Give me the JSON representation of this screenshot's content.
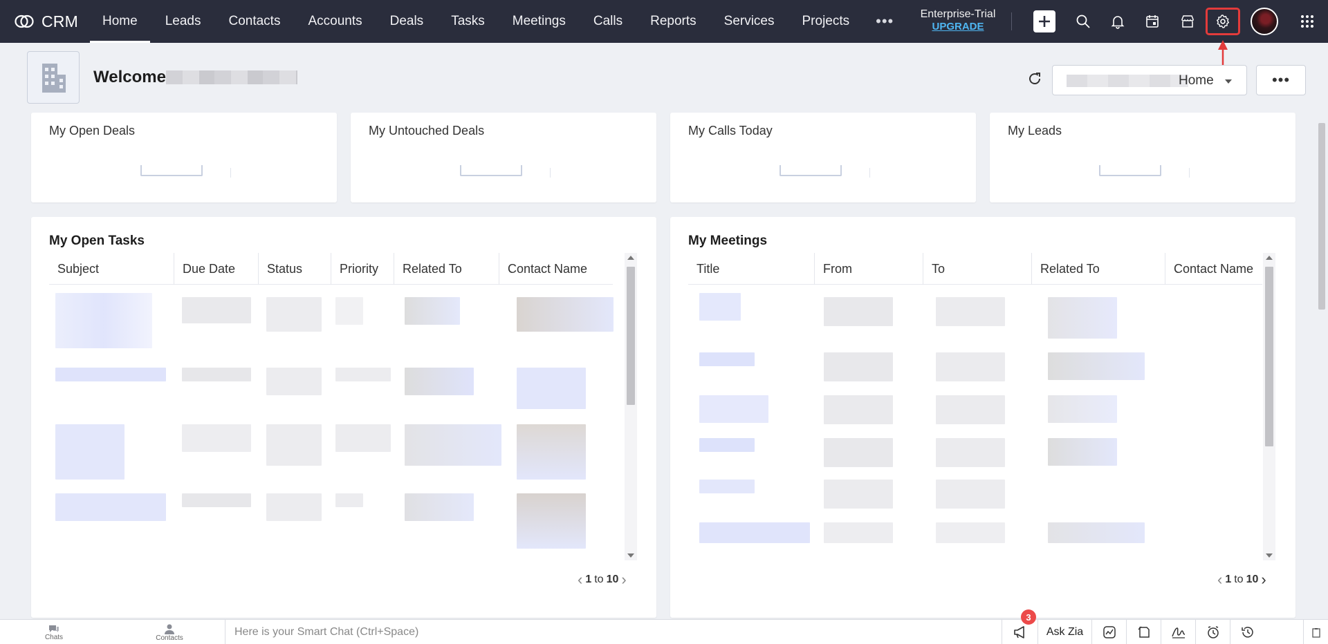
{
  "app": {
    "brand": "CRM"
  },
  "nav": {
    "items": [
      "Home",
      "Leads",
      "Contacts",
      "Accounts",
      "Deals",
      "Tasks",
      "Meetings",
      "Calls",
      "Reports",
      "Services",
      "Projects"
    ],
    "active": "Home",
    "more_label": "•••"
  },
  "edition": {
    "plan": "Enterprise-Trial",
    "upgrade": "UPGRADE"
  },
  "toolbar_icons": [
    "plus-icon",
    "search-icon",
    "bell-icon",
    "calendar-icon",
    "marketplace-icon",
    "gear-icon",
    "avatar",
    "apps-grid-icon"
  ],
  "welcome": {
    "text": "Welcome"
  },
  "home_selector": {
    "value": "Home"
  },
  "more_button": "•••",
  "stat_cards": [
    {
      "title": "My Open Deals"
    },
    {
      "title": "My Untouched Deals"
    },
    {
      "title": "My Calls Today"
    },
    {
      "title": "My Leads"
    }
  ],
  "tasks_panel": {
    "title": "My Open Tasks",
    "columns": [
      "Subject",
      "Due Date",
      "Status",
      "Priority",
      "Related To",
      "Contact Name"
    ],
    "pager": {
      "from": "1",
      "to_word": "to",
      "to": "10"
    }
  },
  "meetings_panel": {
    "title": "My Meetings",
    "columns": [
      "Title",
      "From",
      "To",
      "Related To",
      "Contact Name"
    ],
    "pager": {
      "from": "1",
      "to_word": "to",
      "to": "10"
    }
  },
  "bottom_bar": {
    "chats": "Chats",
    "contacts": "Contacts",
    "smart_chat_placeholder": "Here is your Smart Chat (Ctrl+Space)",
    "notification_count": "3",
    "ask_zia": "Ask Zia"
  },
  "colors": {
    "topbar": "#2a2d3c",
    "accent": "#4fb6f2",
    "highlight": "#e33b3b"
  }
}
